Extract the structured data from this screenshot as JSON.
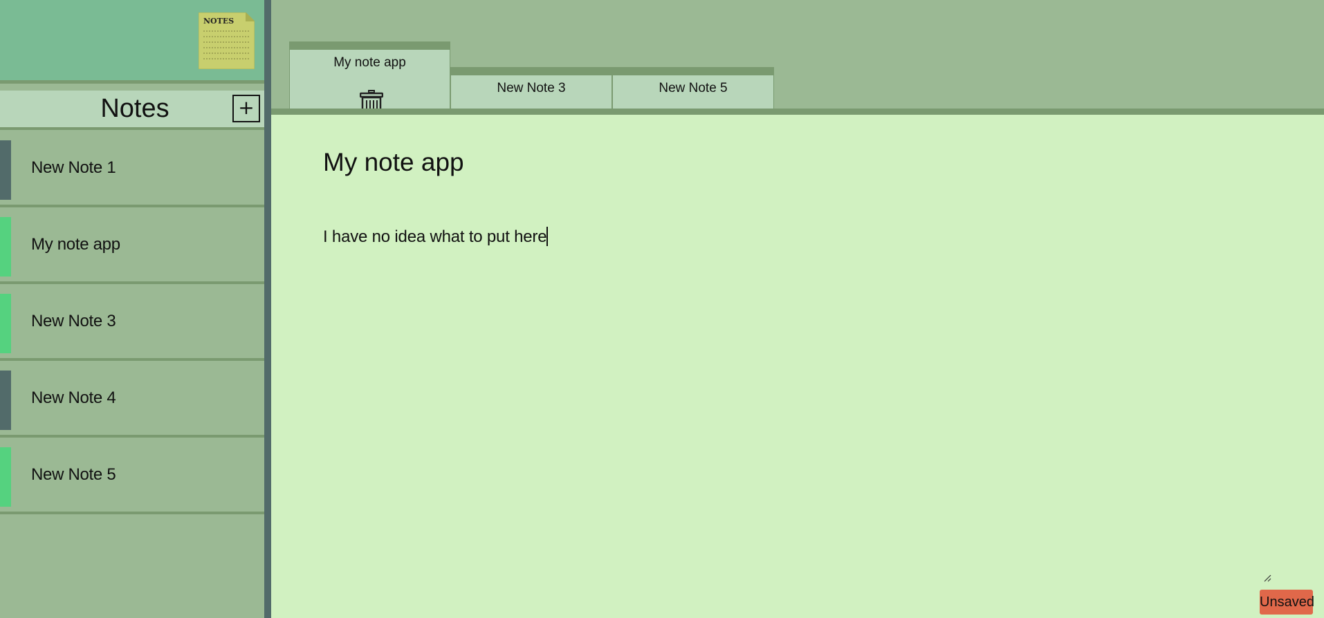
{
  "sidebar": {
    "logo_text": "NOTES",
    "title": "Notes",
    "add_label": "+",
    "items": [
      {
        "label": "New Note 1",
        "open": false
      },
      {
        "label": "My note app",
        "open": true
      },
      {
        "label": "New Note 3",
        "open": true
      },
      {
        "label": "New Note 4",
        "open": false
      },
      {
        "label": "New Note 5",
        "open": true
      }
    ]
  },
  "tabs": [
    {
      "label": "My note app",
      "active": true
    },
    {
      "label": "New Note 3",
      "active": false
    },
    {
      "label": "New Note 5",
      "active": false
    }
  ],
  "editor": {
    "title": "My note app",
    "body": "I have no idea what to put here",
    "status": "Unsaved"
  },
  "colors": {
    "open_marker": "#55d27f",
    "closed_marker": "#526b6a",
    "status_unsaved": "#e0684a",
    "editor_bg": "#d1f1c1",
    "sidebar_bg": "#9bb994"
  },
  "icons": {
    "logo": "notepad-icon",
    "tab_close": "trash-icon",
    "resize": "resize-grip-icon"
  }
}
